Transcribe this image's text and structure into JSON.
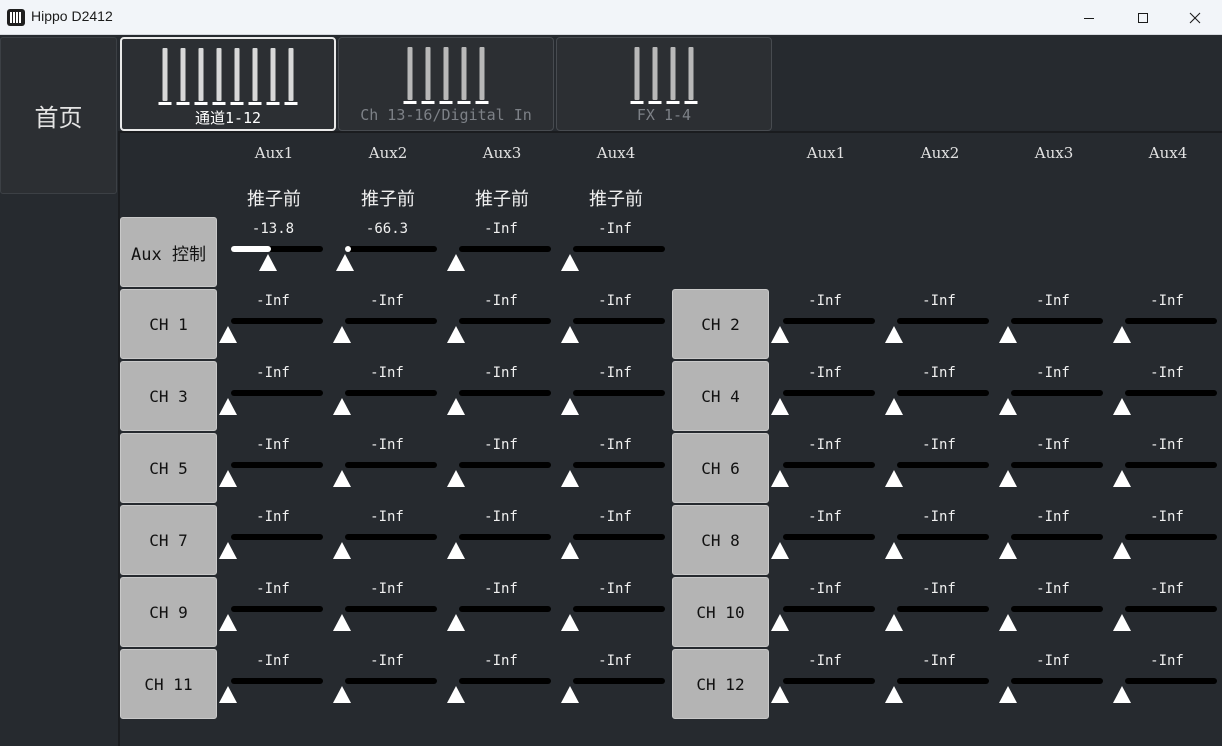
{
  "window": {
    "title": "Hippo D2412",
    "controls": [
      "minimize-icon",
      "maximize-icon",
      "close-icon"
    ]
  },
  "nav": {
    "home_label": "首页"
  },
  "tabs": [
    {
      "label": "通道1-12",
      "active": true,
      "icon": "faders-icon",
      "bars": 8
    },
    {
      "label": "Ch 13-16/Digital In",
      "active": false,
      "icon": "faders-icon",
      "bars": 5
    },
    {
      "label": "FX 1-4",
      "active": false,
      "icon": "faders-icon",
      "bars": 4
    }
  ],
  "headers": {
    "left": [
      "Aux1",
      "Aux2",
      "Aux3",
      "Aux4"
    ],
    "right": [
      "Aux1",
      "Aux2",
      "Aux3",
      "Aux4"
    ],
    "pre_fader": [
      "推子前",
      "推子前",
      "推子前",
      "推子前"
    ]
  },
  "aux_control": {
    "label": "Aux 控制",
    "sends": [
      {
        "value": "-13.8",
        "level": 0.43
      },
      {
        "value": "-66.3",
        "level": 0.03
      },
      {
        "value": "-Inf",
        "level": 0
      },
      {
        "value": "-Inf",
        "level": 0
      }
    ]
  },
  "channels": [
    {
      "label": "CH 1",
      "sends": [
        "-Inf",
        "-Inf",
        "-Inf",
        "-Inf"
      ]
    },
    {
      "label": "CH 2",
      "sends": [
        "-Inf",
        "-Inf",
        "-Inf",
        "-Inf"
      ]
    },
    {
      "label": "CH 3",
      "sends": [
        "-Inf",
        "-Inf",
        "-Inf",
        "-Inf"
      ]
    },
    {
      "label": "CH 4",
      "sends": [
        "-Inf",
        "-Inf",
        "-Inf",
        "-Inf"
      ]
    },
    {
      "label": "CH 5",
      "sends": [
        "-Inf",
        "-Inf",
        "-Inf",
        "-Inf"
      ]
    },
    {
      "label": "CH 6",
      "sends": [
        "-Inf",
        "-Inf",
        "-Inf",
        "-Inf"
      ]
    },
    {
      "label": "CH 7",
      "sends": [
        "-Inf",
        "-Inf",
        "-Inf",
        "-Inf"
      ]
    },
    {
      "label": "CH 8",
      "sends": [
        "-Inf",
        "-Inf",
        "-Inf",
        "-Inf"
      ]
    },
    {
      "label": "CH 9",
      "sends": [
        "-Inf",
        "-Inf",
        "-Inf",
        "-Inf"
      ]
    },
    {
      "label": "CH 10",
      "sends": [
        "-Inf",
        "-Inf",
        "-Inf",
        "-Inf"
      ]
    },
    {
      "label": "CH 11",
      "sends": [
        "-Inf",
        "-Inf",
        "-Inf",
        "-Inf"
      ]
    },
    {
      "label": "CH 12",
      "sends": [
        "-Inf",
        "-Inf",
        "-Inf",
        "-Inf"
      ]
    }
  ],
  "colors": {
    "background": "#262a2f",
    "button": "#b4b4b4",
    "track": "#000000",
    "thumb": "#ffffff"
  }
}
